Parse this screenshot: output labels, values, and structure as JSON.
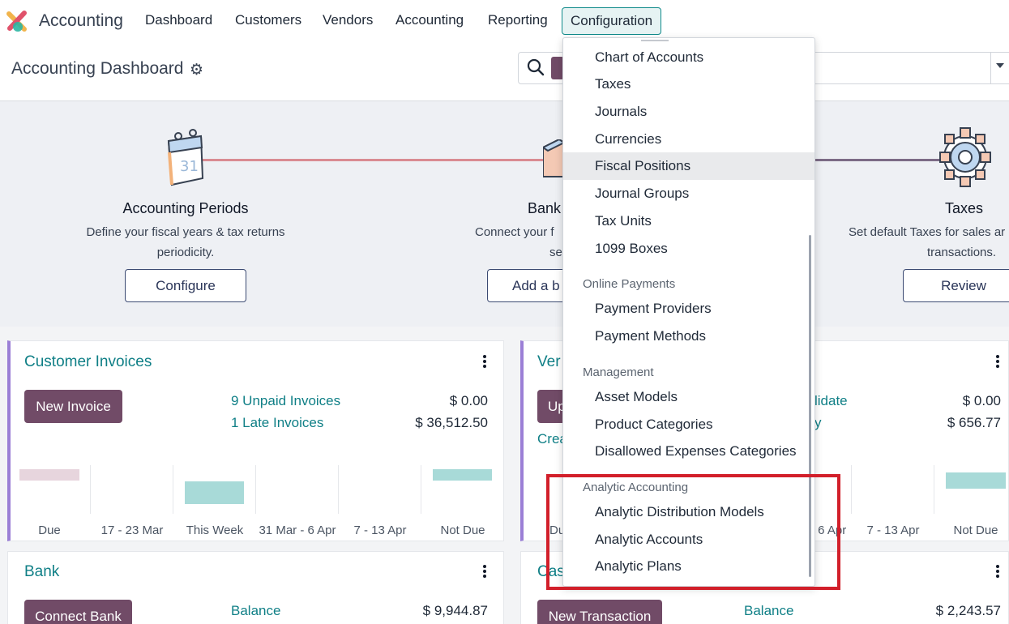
{
  "navbar": {
    "app_name": "Accounting",
    "menu": [
      "Dashboard",
      "Customers",
      "Vendors",
      "Accounting",
      "Reporting",
      "Configuration"
    ]
  },
  "control_panel": {
    "title": "Accounting Dashboard"
  },
  "onboarding": {
    "steps": [
      {
        "title": "Accounting Periods",
        "desc1": "Define your fiscal years & tax returns",
        "desc2": "periodicity.",
        "button": "Configure"
      },
      {
        "title": "Bank",
        "desc1": "Connect your f",
        "desc2": "se",
        "button": "Add a b"
      },
      {
        "title": "Taxes",
        "desc1": "Set default Taxes for sales ar",
        "desc2": "transactions.",
        "button": "Review"
      }
    ]
  },
  "cards": {
    "customer_invoices": {
      "title": "Customer Invoices",
      "button": "New Invoice",
      "links": [
        "9 Unpaid Invoices",
        "1 Late Invoices"
      ],
      "amounts": [
        "$ 0.00",
        "$ 36,512.50"
      ],
      "graph_labels": [
        "Due",
        "17 - 23 Mar",
        "This Week",
        "31 Mar - 6 Apr",
        "7 - 13 Apr",
        "Not Due"
      ]
    },
    "vendor_bills": {
      "title": "Ver",
      "button": "Up",
      "create_link": "Crea",
      "links": [
        "lidate",
        "y"
      ],
      "amounts": [
        "$ 0.00",
        "$ 656.77"
      ],
      "graph_labels": [
        "Du",
        "- 6 Apr",
        "7 - 13 Apr",
        "Not Due"
      ]
    },
    "bank": {
      "title": "Bank",
      "button": "Connect Bank",
      "link": "Balance",
      "amount": "$ 9,944.87"
    },
    "cash": {
      "title": "Cas",
      "button": "New Transaction",
      "link": "Balance",
      "amount": "$ 2,243.57"
    }
  },
  "dropdown": {
    "top_items": [
      "Chart of Accounts",
      "Taxes",
      "Journals",
      "Currencies",
      "Fiscal Positions",
      "Journal Groups",
      "Tax Units",
      "1099 Boxes"
    ],
    "online_payments": {
      "header": "Online Payments",
      "items": [
        "Payment Providers",
        "Payment Methods"
      ]
    },
    "management": {
      "header": "Management",
      "items": [
        "Asset Models",
        "Product Categories",
        "Disallowed Expenses Categories"
      ]
    },
    "analytic": {
      "header": "Analytic Accounting",
      "items": [
        "Analytic Distribution Models",
        "Analytic Accounts",
        "Analytic Plans"
      ]
    }
  },
  "colors": {
    "brand": "#714b67",
    "teal_link": "#0f7f86",
    "highlight_box": "#d21f2a",
    "bar_teal": "#a8dad8",
    "bar_pink": "#e7d5dd"
  }
}
